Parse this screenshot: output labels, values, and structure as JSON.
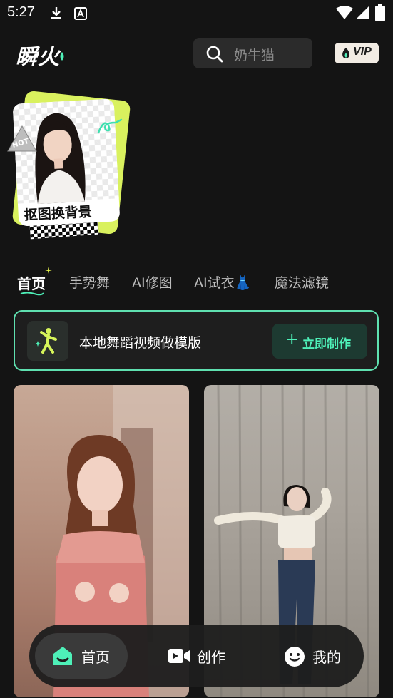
{
  "status_bar": {
    "time": "5:27",
    "icons": [
      "download-icon",
      "keyboard-a-icon",
      "wifi-icon",
      "signal-icon",
      "battery-icon"
    ]
  },
  "header": {
    "logo_text": "瞬火",
    "search_placeholder": "奶牛猫",
    "vip_label": "VIP"
  },
  "feature_card": {
    "badge": "HOT",
    "label": "抠图换背景"
  },
  "tabs": [
    {
      "label": "首页",
      "active": true
    },
    {
      "label": "手势舞",
      "active": false
    },
    {
      "label": "AI修图",
      "active": false
    },
    {
      "label": "AI试衣👗",
      "active": false
    },
    {
      "label": "魔法滤镜",
      "active": false
    }
  ],
  "banner": {
    "title": "本地舞蹈视频做模版",
    "button_label": "立即制作"
  },
  "bottom_nav": [
    {
      "label": "首页",
      "icon": "home-smile-icon",
      "active": true
    },
    {
      "label": "创作",
      "icon": "video-camera-icon",
      "active": false
    },
    {
      "label": "我的",
      "icon": "smiley-face-icon",
      "active": false
    }
  ],
  "colors": {
    "accent": "#4ef0b8",
    "background": "#141414",
    "banner_border": "#5fe0b0",
    "feature_yellow": "#d9f15e"
  }
}
